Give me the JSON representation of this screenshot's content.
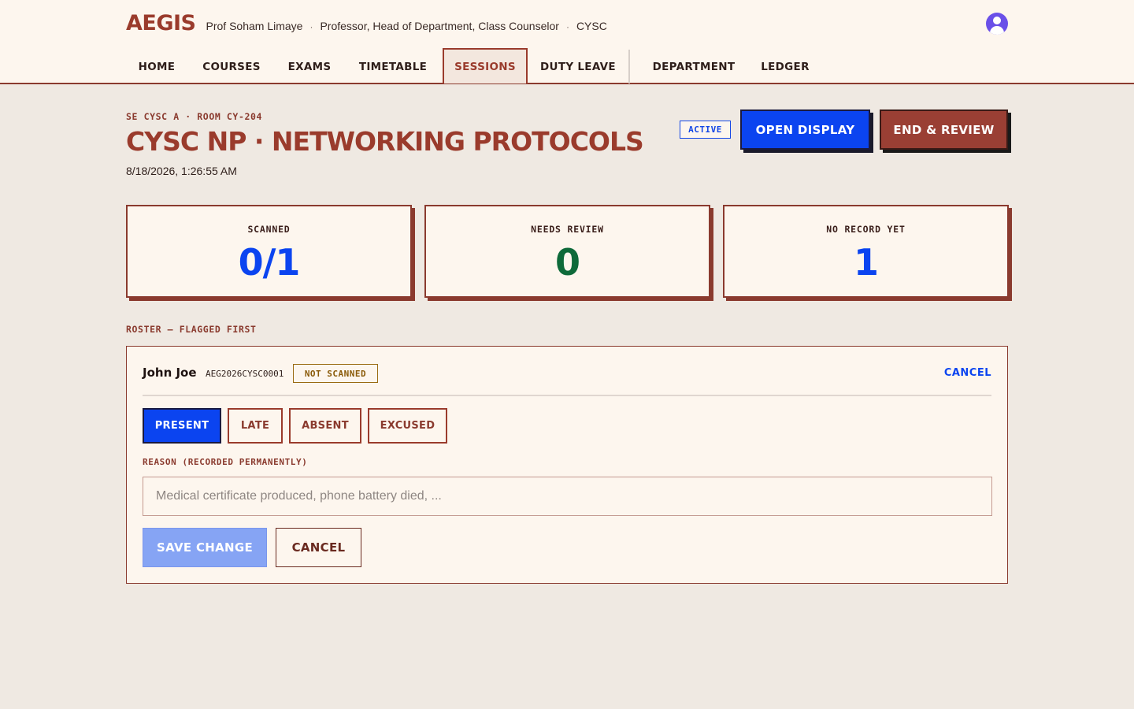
{
  "app": {
    "logo": "AEGIS",
    "user_name": "Prof Soham Limaye",
    "user_roles": "Professor, Head of Department, Class Counselor",
    "user_dept": "CYSC",
    "separator": "·",
    "avatar_icon": "user-avatar-icon",
    "accent_color": "#9a3b2c"
  },
  "nav": {
    "items": [
      {
        "label": "HOME"
      },
      {
        "label": "COURSES"
      },
      {
        "label": "EXAMS"
      },
      {
        "label": "TIMETABLE"
      },
      {
        "label": "SESSIONS",
        "active": true
      },
      {
        "label": "DUTY LEAVE"
      },
      {
        "label": "DEPARTMENT"
      },
      {
        "label": "LEDGER"
      }
    ]
  },
  "session": {
    "eyebrow": "SE CYSC A · ROOM CY-204",
    "title": "CYSC NP · NETWORKING PROTOCOLS",
    "timestamp": "8/18/2026, 1:26:55 AM",
    "status": "ACTIVE",
    "open_display_label": "OPEN DISPLAY",
    "end_review_label": "END & REVIEW"
  },
  "stats": [
    {
      "label": "SCANNED",
      "value": "0/1",
      "color": "#0b44f0"
    },
    {
      "label": "NEEDS REVIEW",
      "value": "0",
      "color": "#0e6a3a"
    },
    {
      "label": "NO RECORD YET",
      "value": "1",
      "color": "#0b44f0"
    }
  ],
  "roster": {
    "heading": "ROSTER — FLAGGED FIRST",
    "student": {
      "name": "John Joe",
      "id": "AEG2026CYSC0001",
      "scan_status": "NOT SCANNED"
    },
    "cancel_link": "CANCEL",
    "status_options": [
      {
        "label": "PRESENT",
        "selected": true
      },
      {
        "label": "LATE"
      },
      {
        "label": "ABSENT"
      },
      {
        "label": "EXCUSED"
      }
    ],
    "reason_label": "REASON (RECORDED PERMANENTLY)",
    "reason_value": "",
    "reason_placeholder": "Medical certificate produced, phone battery died, ...",
    "save_label": "SAVE CHANGE",
    "cancel_label": "CANCEL"
  }
}
